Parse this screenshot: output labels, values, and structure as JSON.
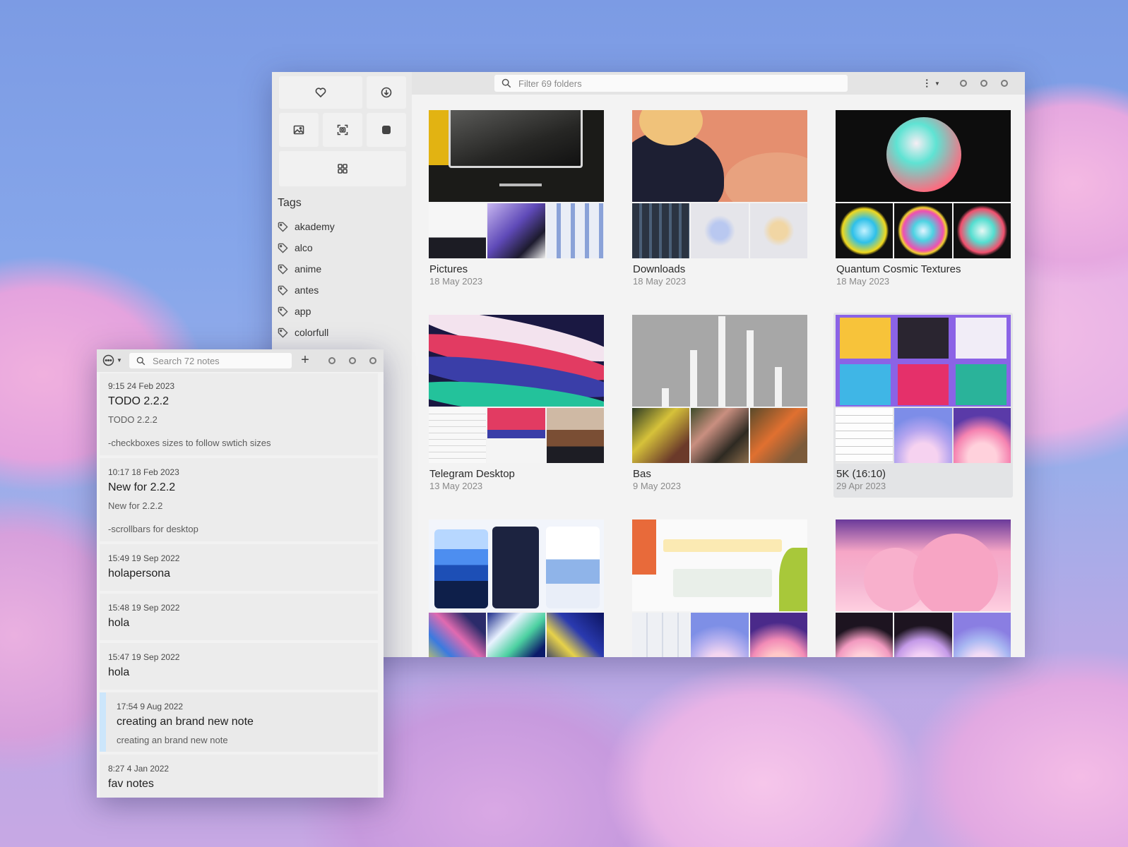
{
  "gallery": {
    "search_placeholder": "Filter 69 folders",
    "tags_title": "Tags",
    "tags": [
      "akademy",
      "alco",
      "anime",
      "antes",
      "app",
      "colorfull"
    ],
    "quick_buttons": [
      "heart-icon",
      "download-icon",
      "image-icon",
      "screenshot-icon",
      "square-icon",
      "grid-icon"
    ],
    "folders": [
      {
        "name": "Pictures",
        "date": "18 May 2023"
      },
      {
        "name": "Downloads",
        "date": "18 May 2023"
      },
      {
        "name": "Quantum Cosmic Textures",
        "date": "18 May 2023"
      },
      {
        "name": "Telegram Desktop",
        "date": "13 May 2023"
      },
      {
        "name": "Bas",
        "date": "9 May 2023"
      },
      {
        "name": "5K (16:10)",
        "date": "29 Apr 2023"
      },
      {
        "name": "",
        "date": ""
      },
      {
        "name": "",
        "date": ""
      },
      {
        "name": "",
        "date": ""
      }
    ]
  },
  "notes": {
    "search_placeholder": "Search 72 notes",
    "add_label": "+",
    "items": [
      {
        "time": "9:15 24 Feb 2023",
        "title": "TODO 2.2.2",
        "line1": "TODO 2.2.2",
        "line2": "-checkboxes sizes to follow swtich sizes"
      },
      {
        "time": "10:17 18 Feb 2023",
        "title": "New for 2.2.2",
        "line1": "New for 2.2.2",
        "line2": "-scrollbars for desktop"
      },
      {
        "time": "15:49 19 Sep 2022",
        "title": "holapersona"
      },
      {
        "time": "15:48 19 Sep 2022",
        "title": "hola"
      },
      {
        "time": "15:47 19 Sep 2022",
        "title": "hola"
      },
      {
        "time": "17:54 9 Aug 2022",
        "title": "creating an brand new note",
        "line1": "creating an brand new note"
      },
      {
        "time": "8:27 4 Jan 2022",
        "title": "fav notes"
      }
    ]
  },
  "colors": {
    "selected_note_bar": "#cce6fb",
    "window_bg": "#f3f3f3",
    "sidebar_bg": "#e9e9e9"
  }
}
